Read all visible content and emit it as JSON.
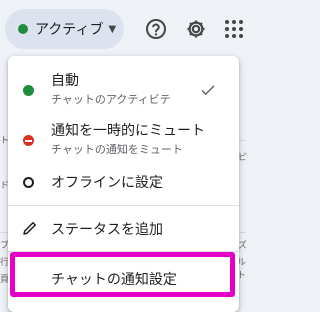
{
  "header": {
    "status_chip_label": "アクティブ",
    "status_color": "#1e8e3e"
  },
  "icons": {
    "help": "help-circle-icon",
    "settings": "gear-icon",
    "apps": "apps-grid-icon"
  },
  "menu": {
    "items": [
      {
        "title": "自動",
        "subtitle": "チャットのアクティビテ",
        "icon": "green-dot-icon",
        "selected": true
      },
      {
        "title": "通知を一時的にミュート",
        "subtitle": "チャットの通知をミュート",
        "icon": "red-minus-icon"
      },
      {
        "title": "オフラインに設定",
        "icon": "ring-icon"
      },
      {
        "title": "ステータスを追加",
        "icon": "pencil-icon"
      },
      {
        "title": "チャットの通知設定",
        "highlighted": true
      }
    ]
  },
  "background": {
    "fragments": [
      "ト",
      "ド",
      "プ",
      "行",
      "頁",
      "ピ",
      "ズ",
      "ルト"
    ]
  },
  "colors": {
    "highlight": "#e600c7",
    "mute": "#d93025"
  }
}
